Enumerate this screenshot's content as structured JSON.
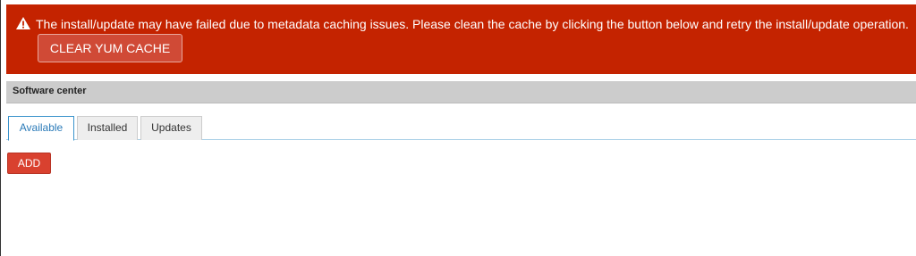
{
  "alert": {
    "icon": "warning-triangle-icon",
    "message": "The install/update may have failed due to metadata caching issues. Please clean the cache by clicking the button below and retry the install/update operation.",
    "button_label": "CLEAR YUM CACHE",
    "background_color": "#c42300"
  },
  "section": {
    "title": "Software center"
  },
  "tabs": [
    {
      "label": "Available",
      "active": true
    },
    {
      "label": "Installed",
      "active": false
    },
    {
      "label": "Updates",
      "active": false
    }
  ],
  "actions": {
    "add_label": "ADD",
    "accent_color": "#d9412f"
  }
}
